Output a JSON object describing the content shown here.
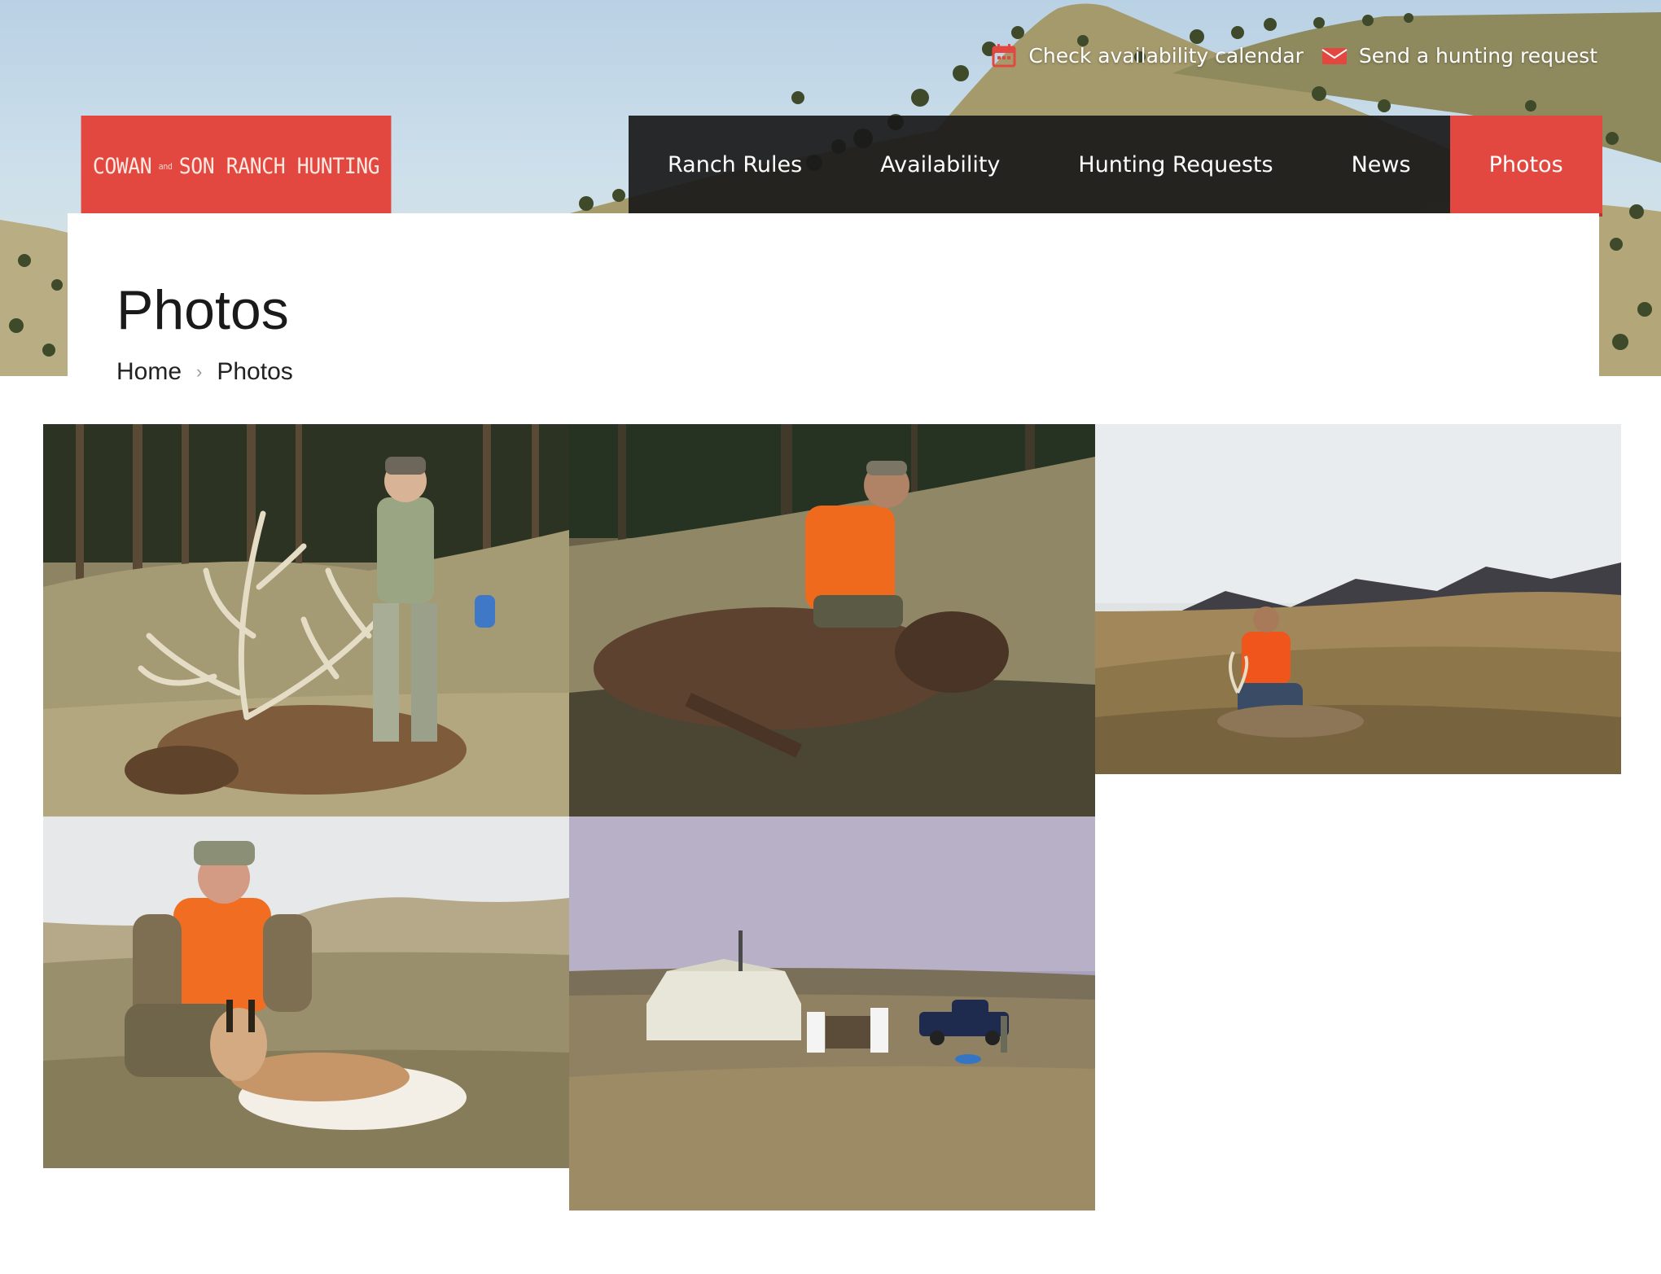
{
  "top_links": [
    {
      "label": "Check availability calendar",
      "icon": "calendar-icon"
    },
    {
      "label": "Send a hunting request",
      "icon": "envelope-icon"
    }
  ],
  "logo": {
    "left": "COWAN",
    "mid": "and",
    "right": "SON RANCH HUNTING"
  },
  "nav": {
    "items": [
      {
        "label": "Ranch Rules"
      },
      {
        "label": "Availability"
      },
      {
        "label": "Hunting Requests"
      },
      {
        "label": "News"
      },
      {
        "label": "Photos",
        "active": true
      }
    ]
  },
  "page": {
    "title": "Photos"
  },
  "breadcrumb": {
    "home": "Home",
    "current": "Photos"
  },
  "colors": {
    "accent": "#e2483f",
    "nav_bg": "#1a1a1a"
  }
}
